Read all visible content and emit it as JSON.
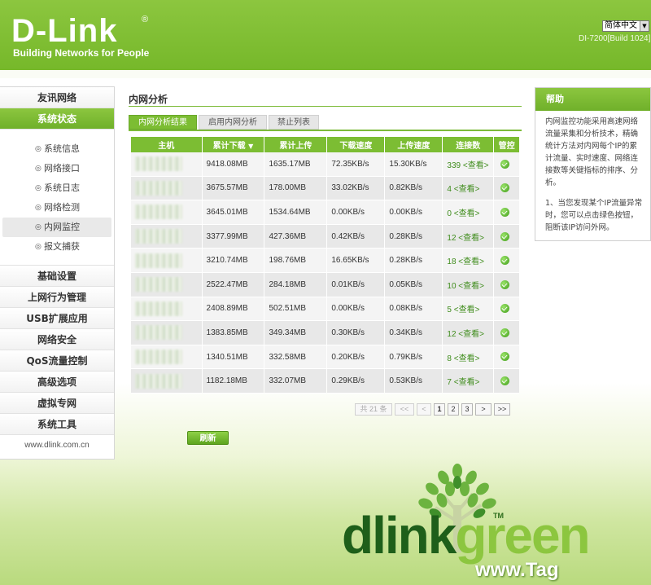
{
  "header": {
    "logo": "D-Link",
    "logo_mark": "®",
    "tagline": "Building Networks for People",
    "language": "简体中文",
    "firmware": "DI-7200[Build 1024]"
  },
  "sidebar": {
    "top_items": [
      {
        "label": "友讯网络"
      },
      {
        "label": "系统状态"
      }
    ],
    "sub_items": [
      {
        "label": "系统信息"
      },
      {
        "label": "网络接口"
      },
      {
        "label": "系统日志"
      },
      {
        "label": "网络检测"
      },
      {
        "label": "内网监控"
      },
      {
        "label": "报文捕获"
      }
    ],
    "bottom_items": [
      {
        "label": "基础设置"
      },
      {
        "label": "上网行为管理"
      },
      {
        "label": "USB扩展应用"
      },
      {
        "label": "网络安全"
      },
      {
        "label": "QoS流量控制"
      },
      {
        "label": "高级选项"
      },
      {
        "label": "虚拟专网"
      },
      {
        "label": "系统工具"
      }
    ],
    "footer": "www.dlink.com.cn"
  },
  "main": {
    "title": "内网分析",
    "tabs": [
      {
        "label": "内网分析结果"
      },
      {
        "label": "启用内网分析"
      },
      {
        "label": "禁止列表"
      }
    ],
    "table": {
      "headers": [
        "主机",
        "累计下载",
        "累计上传",
        "下载速度",
        "上传速度",
        "连接数",
        "管控"
      ],
      "rows": [
        {
          "download": "9418.08MB",
          "upload": "1635.17MB",
          "down_speed": "72.35KB/s",
          "up_speed": "15.30KB/s",
          "connections": "339 <查看>"
        },
        {
          "download": "3675.57MB",
          "upload": "178.00MB",
          "down_speed": "33.02KB/s",
          "up_speed": "0.82KB/s",
          "connections": "4 <查看>"
        },
        {
          "download": "3645.01MB",
          "upload": "1534.64MB",
          "down_speed": "0.00KB/s",
          "up_speed": "0.00KB/s",
          "connections": "0 <查看>"
        },
        {
          "download": "3377.99MB",
          "upload": "427.36MB",
          "down_speed": "0.42KB/s",
          "up_speed": "0.28KB/s",
          "connections": "12 <查看>"
        },
        {
          "download": "3210.74MB",
          "upload": "198.76MB",
          "down_speed": "16.65KB/s",
          "up_speed": "0.28KB/s",
          "connections": "18 <查看>"
        },
        {
          "download": "2522.47MB",
          "upload": "284.18MB",
          "down_speed": "0.01KB/s",
          "up_speed": "0.05KB/s",
          "connections": "10 <查看>"
        },
        {
          "download": "2408.89MB",
          "upload": "502.51MB",
          "down_speed": "0.00KB/s",
          "up_speed": "0.08KB/s",
          "connections": "5 <查看>"
        },
        {
          "download": "1383.85MB",
          "upload": "349.34MB",
          "down_speed": "0.30KB/s",
          "up_speed": "0.34KB/s",
          "connections": "12 <查看>"
        },
        {
          "download": "1340.51MB",
          "upload": "332.58MB",
          "down_speed": "0.20KB/s",
          "up_speed": "0.79KB/s",
          "connections": "8 <查看>"
        },
        {
          "download": "1182.18MB",
          "upload": "332.07MB",
          "down_speed": "0.29KB/s",
          "up_speed": "0.53KB/s",
          "connections": "7 <查看>"
        }
      ]
    },
    "pager": {
      "total": "共 21 条",
      "first": "<<",
      "prev": "<",
      "pages": [
        "1",
        "2",
        "3"
      ],
      "next": ">",
      "last": ">>"
    },
    "refresh_label": "刷新"
  },
  "help": {
    "title": "帮助",
    "paragraphs": [
      "内网监控功能采用高速网络流量采集和分析技术，精确统计方法对内网每个IP的累计流量、实时速度、网络连接数等关键指标的排序、分析。",
      "1、当您发现某个IP流量异常时，您可以点击绿色按钮，阻断该IP访问外网。"
    ]
  },
  "decor": {
    "brand_dlink": "dlink",
    "brand_green": "green",
    "brand_tm": "TM",
    "watermark": "www.Tag"
  },
  "colors": {
    "brand_green": "#7cbd33",
    "dark_green": "#1e5f1a",
    "row_odd": "#f4f4f4",
    "row_even": "#e8e8e8"
  }
}
